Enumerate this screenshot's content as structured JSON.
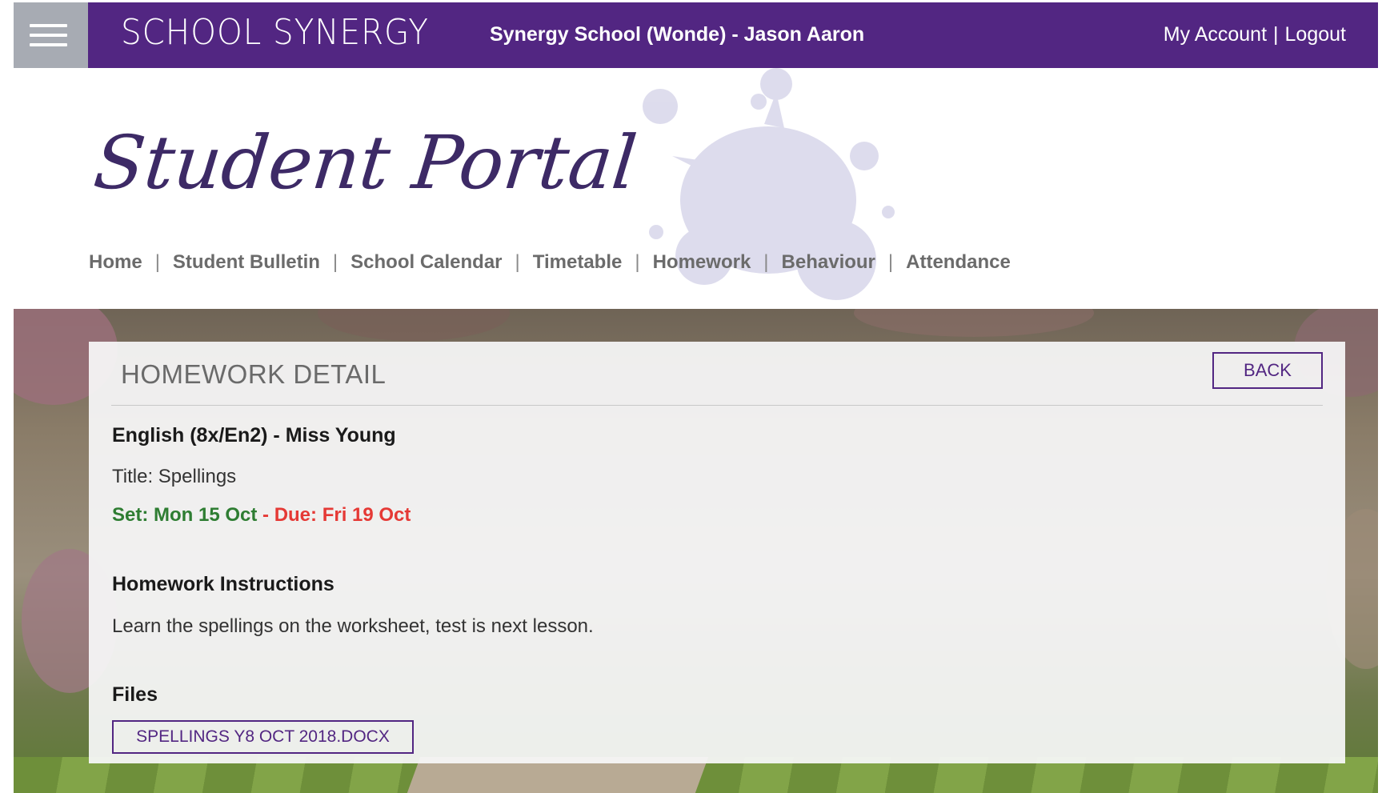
{
  "topbar": {
    "menu_icon": "hamburger-menu-icon",
    "brand": "SCHOOL SYNERGY",
    "school_user": "Synergy School (Wonde) - Jason Aaron",
    "my_account": "My Account",
    "separator": "|",
    "logout": "Logout",
    "bar_color": "#522682"
  },
  "header": {
    "portal_title": "Student Portal"
  },
  "nav": {
    "separator": "|",
    "items": [
      {
        "label": "Home"
      },
      {
        "label": "Student Bulletin"
      },
      {
        "label": "School Calendar"
      },
      {
        "label": "Timetable"
      },
      {
        "label": "Homework"
      },
      {
        "label": "Behaviour"
      },
      {
        "label": "Attendance"
      }
    ]
  },
  "detail": {
    "heading": "HOMEWORK DETAIL",
    "back_label": "BACK",
    "subject": "English (8x/En2) - Miss Young",
    "title": "Title: Spellings",
    "set_date": "Set: Mon 15 Oct",
    "date_separator": " - ",
    "due_date": "Due: Fri 19 Oct",
    "instructions_heading": "Homework Instructions",
    "instructions": "Learn the spellings on the worksheet, test is next lesson.",
    "files_heading": "Files",
    "files": [
      {
        "name": "SPELLINGS Y8 OCT 2018.DOCX"
      }
    ],
    "set_color": "#2e7d32",
    "due_color": "#e53935"
  }
}
